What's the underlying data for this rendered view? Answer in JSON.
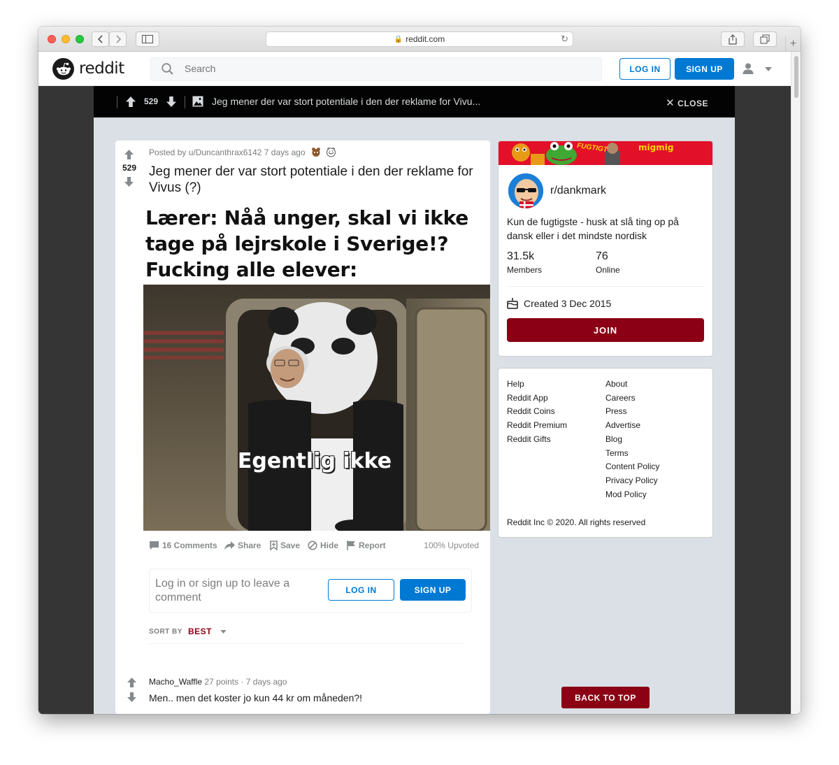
{
  "browser": {
    "url": "reddit.com"
  },
  "header": {
    "logo_text": "reddit",
    "search_placeholder": "Search",
    "login_label": "LOG IN",
    "signup_label": "SIGN UP"
  },
  "overlay": {
    "score": "529",
    "title": "Jeg mener der var stort potentiale i den der reklame for Vivu...",
    "close_label": "CLOSE"
  },
  "post": {
    "score": "529",
    "meta": "Posted by u/Duncanthrax6142 7 days ago",
    "title": "Jeg mener der var stort potentiale i den der reklame for Vivus (?)",
    "meme_top_text": "Lærer: Nåå unger, skal vi ikke tage på lejrskole i Sverige!? Fucking alle elever:",
    "meme_caption": "Egentlig ikke",
    "actions": {
      "comments": "16 Comments",
      "share": "Share",
      "save": "Save",
      "hide": "Hide",
      "report": "Report",
      "upvoted": "100% Upvoted"
    },
    "comment_prompt": "Log in or sign up to leave a comment",
    "comment_login": "LOG IN",
    "comment_signup": "SIGN UP",
    "sort_label": "SORT BY",
    "sort_value": "BEST"
  },
  "comment": {
    "author": "Macho_Waffle",
    "meta": "27 points · 7 days ago",
    "body": "Men.. men det koster jo kun 44 kr om måneden?!"
  },
  "subreddit": {
    "banner_text_1": "FUGTIGT",
    "banner_text_2": "migmig",
    "name": "r/dankmark",
    "description": "Kun de fugtigste - husk at slå ting op på dansk eller i det mindste nordisk",
    "members": "31.5k",
    "members_label": "Members",
    "online": "76",
    "online_label": "Online",
    "created": "Created 3 Dec 2015",
    "join_label": "JOIN"
  },
  "footer": {
    "col1": [
      "Help",
      "Reddit App",
      "Reddit Coins",
      "Reddit Premium",
      "Reddit Gifts"
    ],
    "col2": [
      "About",
      "Careers",
      "Press",
      "Advertise",
      "Blog",
      "Terms",
      "Content Policy",
      "Privacy Policy",
      "Mod Policy"
    ],
    "copyright": "Reddit Inc © 2020. All rights reserved"
  },
  "back_to_top": "BACK TO TOP",
  "colors": {
    "brand_blue": "#0079d3",
    "subreddit_accent": "#8b0014",
    "overlay_bg": "#030303",
    "page_bg": "#dae0e6"
  },
  "icons": [
    "upvote-icon",
    "downvote-icon",
    "search-icon",
    "user-icon",
    "chevron-down-icon",
    "image-icon",
    "close-icon",
    "comment-icon",
    "share-icon",
    "save-icon",
    "hide-icon",
    "report-icon",
    "cake-icon",
    "award-icon"
  ]
}
